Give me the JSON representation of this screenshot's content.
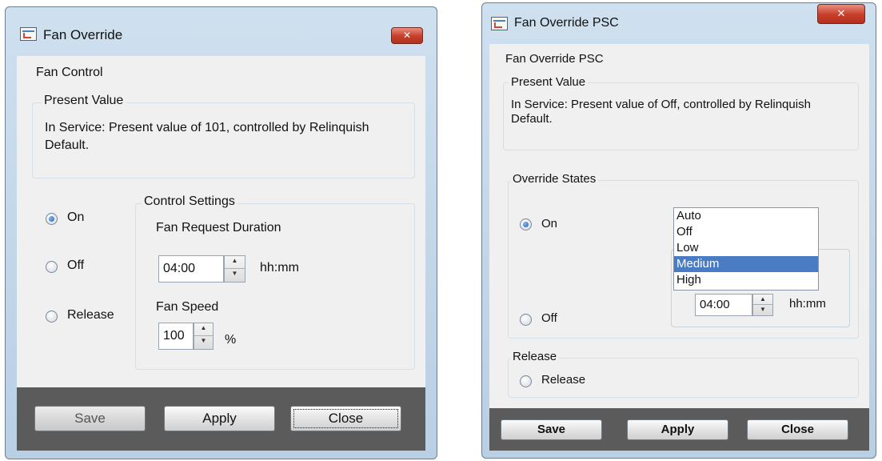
{
  "left_dialog": {
    "title": "Fan Override",
    "close_glyph": "✕",
    "header_label": "Fan Control",
    "present_value": {
      "legend": "Present Value",
      "text": "In Service: Present value of 101, controlled by Relinquish Default."
    },
    "radios": [
      {
        "label": "On",
        "checked": true
      },
      {
        "label": "Off",
        "checked": false
      },
      {
        "label": "Release",
        "checked": false
      }
    ],
    "control_settings": {
      "legend": "Control Settings",
      "duration_label": "Fan Request Duration",
      "duration_value": "04:00",
      "duration_unit": "hh:mm",
      "speed_label": "Fan Speed",
      "speed_value": "100",
      "speed_unit": "%"
    },
    "buttons": {
      "save": "Save",
      "apply": "Apply",
      "close": "Close"
    },
    "save_enabled": false
  },
  "right_dialog": {
    "title": "Fan Override PSC",
    "close_glyph": "✕",
    "header_label": "Fan Override PSC",
    "present_value": {
      "legend": "Present Value",
      "text": "In Service: Present value of Off, controlled by Relinquish Default."
    },
    "override_states": {
      "legend": "Override States",
      "radios": [
        {
          "label": "On",
          "checked": true
        },
        {
          "label": "Off",
          "checked": false
        }
      ],
      "dropdown_options": [
        "Auto",
        "Off",
        "Low",
        "Medium",
        "High"
      ],
      "selected_option": "Medium",
      "duration_value": "04:00",
      "duration_unit": "hh:mm"
    },
    "release": {
      "legend": "Release",
      "radio_label": "Release",
      "checked": false
    },
    "buttons": {
      "save": "Save",
      "apply": "Apply",
      "close": "Close"
    }
  },
  "colors": {
    "title_gradient_top": "#cfe0ef",
    "title_gradient_bottom": "#b9cfe4",
    "close_button": "#c8402c",
    "footer": "#5b5b5b",
    "selection": "#4a7cc4"
  },
  "icons": [
    "app-icon",
    "close-icon",
    "spin-up-icon",
    "spin-down-icon"
  ]
}
